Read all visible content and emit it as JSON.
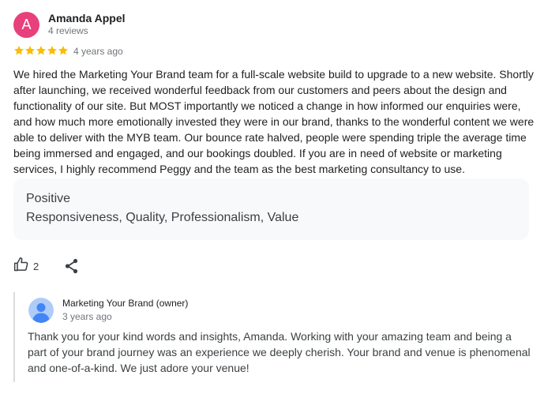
{
  "review": {
    "author": {
      "initial": "A",
      "name": "Amanda Appel",
      "meta": "4 reviews",
      "avatar_color": "#e8407a"
    },
    "rating": 5,
    "star_color": "#fbbc04",
    "time": "4 years ago",
    "text": "We hired the Marketing Your Brand team for a full-scale website build to upgrade to a new website. Shortly after launching, we received wonderful feedback from our customers and peers about the design and functionality of our site. But MOST importantly we noticed a change in how informed our enquiries were, and how much more emotionally invested they were in our brand, thanks to the wonderful content we were able to deliver with the MYB team. Our bounce rate halved, people were spending triple the average time being immersed and engaged, and our bookings doubled. If you are in need of website or marketing services, I highly recommend Peggy and the team as the best marketing consultancy to use.",
    "attributes": {
      "title": "Positive",
      "values": "Responsiveness, Quality, Professionalism, Value"
    },
    "actions": {
      "like_count": "2",
      "like_icon": "thumb-up-icon",
      "share_icon": "share-icon"
    }
  },
  "owner_response": {
    "name": "Marketing Your Brand (owner)",
    "time": "3 years ago",
    "text": "Thank you for your kind words and insights, Amanda. Working with your amazing team and being a part of your brand journey was an experience we deeply cherish. Your brand and venue is phenomenal and one-of-a-kind. We just adore your venue!",
    "avatar_icon": "person-icon",
    "avatar_color": "#aecbfa",
    "avatar_figure_color": "#4285f4"
  }
}
